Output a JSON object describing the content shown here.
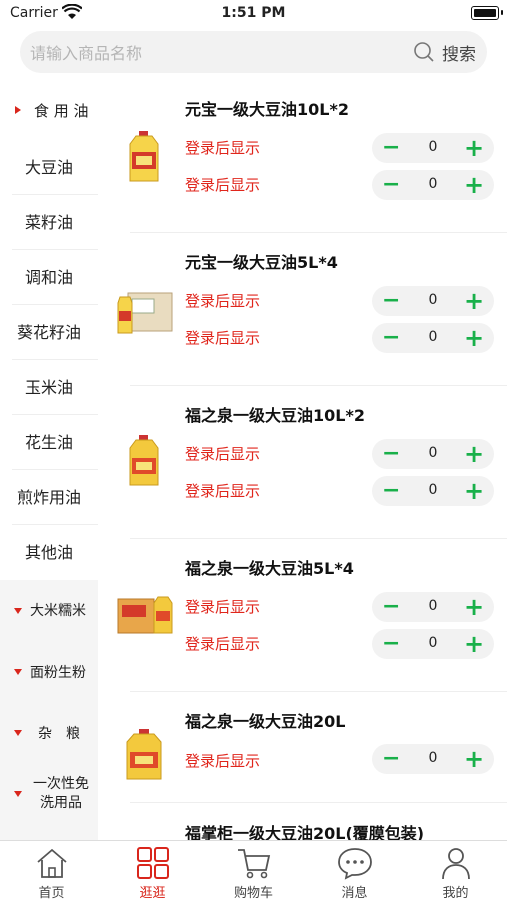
{
  "status_bar": {
    "carrier": "Carrier",
    "time": "1:51 PM"
  },
  "search": {
    "placeholder": "请输入商品名称",
    "button_label": "搜索"
  },
  "sidebar": {
    "active_category": "食 用 油",
    "subcategories": [
      "大豆油",
      "菜籽油",
      "调和油",
      "葵花籽油",
      "玉米油",
      "花生油",
      "煎炸用油",
      "其他油"
    ],
    "categories": [
      "大米糯米",
      "面粉生粉",
      "杂　粮",
      "一次性免洗用品"
    ]
  },
  "products": [
    {
      "name": "元宝一级大豆油10L*2",
      "image": "oil-bottle-image",
      "rows": [
        {
          "price": "登录后显示",
          "qty": "0"
        },
        {
          "price": "登录后显示",
          "qty": "0"
        }
      ]
    },
    {
      "name": "元宝一级大豆油5L*4",
      "image": "oil-carton-image",
      "rows": [
        {
          "price": "登录后显示",
          "qty": "0"
        },
        {
          "price": "登录后显示",
          "qty": "0"
        }
      ]
    },
    {
      "name": "福之泉一级大豆油10L*2",
      "image": "oil-bottle-image",
      "rows": [
        {
          "price": "登录后显示",
          "qty": "0"
        },
        {
          "price": "登录后显示",
          "qty": "0"
        }
      ]
    },
    {
      "name": "福之泉一级大豆油5L*4",
      "image": "oil-carton-image",
      "rows": [
        {
          "price": "登录后显示",
          "qty": "0"
        },
        {
          "price": "登录后显示",
          "qty": "0"
        }
      ]
    },
    {
      "name": "福之泉一级大豆油20L",
      "image": "oil-bottle-image",
      "rows": [
        {
          "price": "登录后显示",
          "qty": "0"
        }
      ]
    },
    {
      "name": "福掌柜一级大豆油20L(覆膜包装)"
    }
  ],
  "stepper": {
    "minus": "−",
    "plus": "+"
  },
  "tabbar": {
    "active": "逛逛",
    "items": [
      {
        "label": "首页",
        "icon": "home-icon"
      },
      {
        "label": "逛逛",
        "icon": "grid-icon"
      },
      {
        "label": "购物车",
        "icon": "cart-icon"
      },
      {
        "label": "消息",
        "icon": "message-icon"
      },
      {
        "label": "我的",
        "icon": "profile-icon"
      }
    ]
  },
  "colors": {
    "accent_red": "#d9261c",
    "price_red": "#e0261c",
    "stepper_green": "#19b04a"
  }
}
